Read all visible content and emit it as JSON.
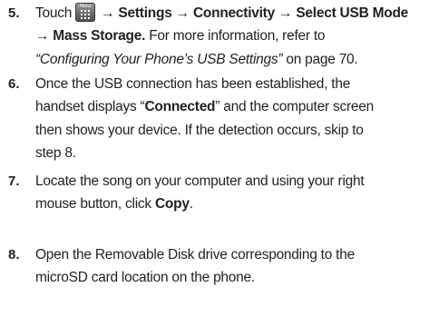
{
  "steps": [
    {
      "number": "5.",
      "touch": "Touch",
      "menu_icon_label": "Menu",
      "icon": "menu-key-icon",
      "path": "→ Settings → Connectivity → Select USB Mode",
      "path2": "→ Mass Storage.",
      "text1": " For more information, refer to",
      "ref": "“Configuring Your Phone’s USB Settings”",
      "text2": " on page 70."
    },
    {
      "number": "6.",
      "line1": "Once the USB connection has been established, the",
      "pre": "handset displays “",
      "bold": "Connected",
      "post": "” and the computer screen",
      "line3": "then shows your device. If the detection occurs, skip to",
      "line4": "step 8."
    },
    {
      "number": "7.",
      "line1": "Locate the song on your computer and using your right",
      "pre": "mouse button, click ",
      "bold": "Copy",
      "post": "."
    },
    {
      "number": "8.",
      "line1": "Open the Removable Disk drive corresponding to the",
      "line2": "microSD card location on the phone."
    }
  ]
}
